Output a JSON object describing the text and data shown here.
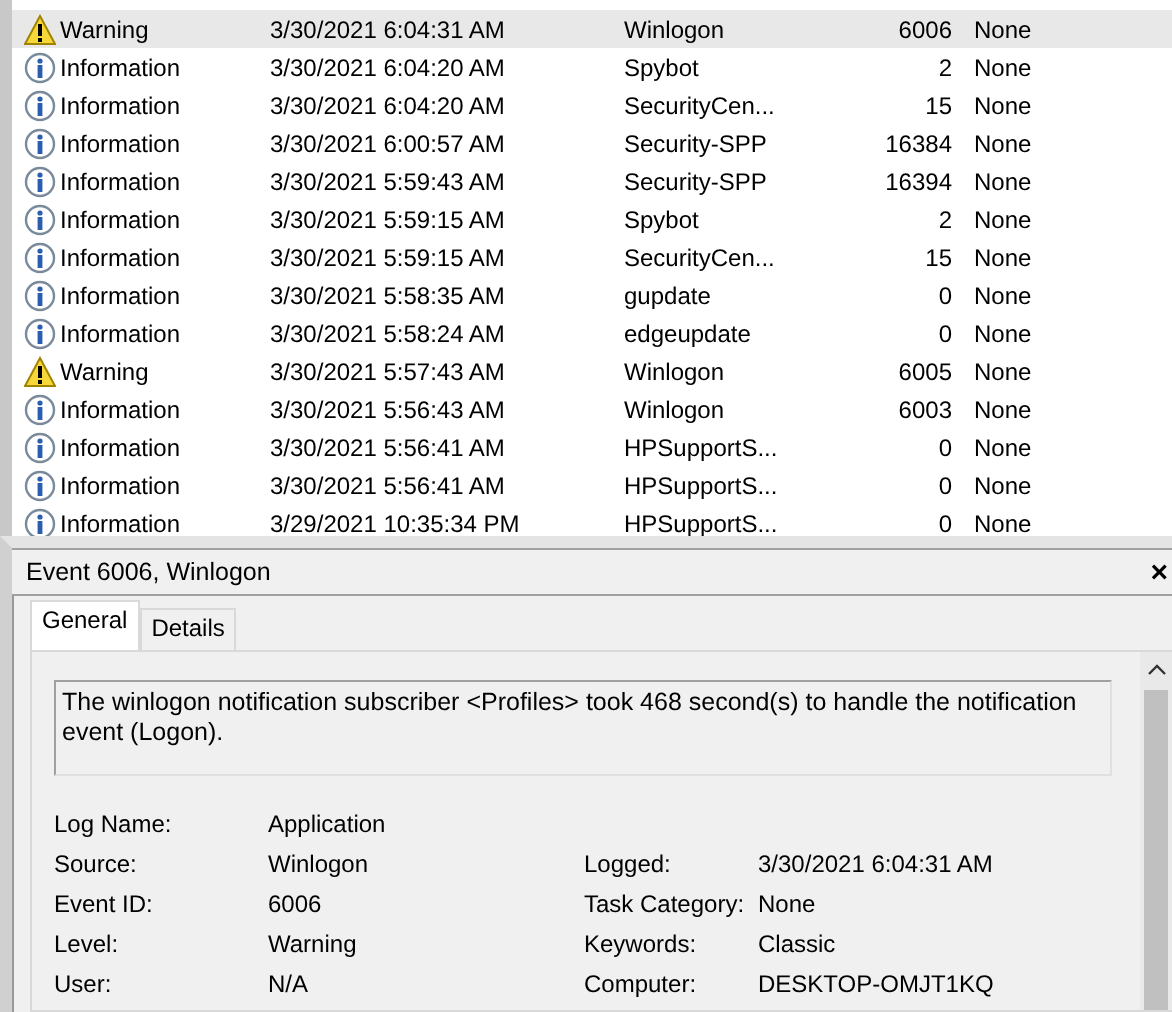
{
  "events": [
    {
      "kind": "warning",
      "level": "Warning",
      "date": "3/30/2021 6:04:31 AM",
      "source": "Winlogon",
      "event_id": "6006",
      "task": "None",
      "selected": true
    },
    {
      "kind": "information",
      "level": "Information",
      "date": "3/30/2021 6:04:20 AM",
      "source": "Spybot",
      "event_id": "2",
      "task": "None",
      "selected": false
    },
    {
      "kind": "information",
      "level": "Information",
      "date": "3/30/2021 6:04:20 AM",
      "source": "SecurityCen...",
      "event_id": "15",
      "task": "None",
      "selected": false
    },
    {
      "kind": "information",
      "level": "Information",
      "date": "3/30/2021 6:00:57 AM",
      "source": "Security-SPP",
      "event_id": "16384",
      "task": "None",
      "selected": false
    },
    {
      "kind": "information",
      "level": "Information",
      "date": "3/30/2021 5:59:43 AM",
      "source": "Security-SPP",
      "event_id": "16394",
      "task": "None",
      "selected": false
    },
    {
      "kind": "information",
      "level": "Information",
      "date": "3/30/2021 5:59:15 AM",
      "source": "Spybot",
      "event_id": "2",
      "task": "None",
      "selected": false
    },
    {
      "kind": "information",
      "level": "Information",
      "date": "3/30/2021 5:59:15 AM",
      "source": "SecurityCen...",
      "event_id": "15",
      "task": "None",
      "selected": false
    },
    {
      "kind": "information",
      "level": "Information",
      "date": "3/30/2021 5:58:35 AM",
      "source": "gupdate",
      "event_id": "0",
      "task": "None",
      "selected": false
    },
    {
      "kind": "information",
      "level": "Information",
      "date": "3/30/2021 5:58:24 AM",
      "source": "edgeupdate",
      "event_id": "0",
      "task": "None",
      "selected": false
    },
    {
      "kind": "warning",
      "level": "Warning",
      "date": "3/30/2021 5:57:43 AM",
      "source": "Winlogon",
      "event_id": "6005",
      "task": "None",
      "selected": false
    },
    {
      "kind": "information",
      "level": "Information",
      "date": "3/30/2021 5:56:43 AM",
      "source": "Winlogon",
      "event_id": "6003",
      "task": "None",
      "selected": false
    },
    {
      "kind": "information",
      "level": "Information",
      "date": "3/30/2021 5:56:41 AM",
      "source": "HPSupportS...",
      "event_id": "0",
      "task": "None",
      "selected": false
    },
    {
      "kind": "information",
      "level": "Information",
      "date": "3/30/2021 5:56:41 AM",
      "source": "HPSupportS...",
      "event_id": "0",
      "task": "None",
      "selected": false
    },
    {
      "kind": "information",
      "level": "Information",
      "date": "3/29/2021 10:35:34 PM",
      "source": "HPSupportS...",
      "event_id": "0",
      "task": "None",
      "selected": false
    }
  ],
  "detail": {
    "title": "Event 6006, Winlogon",
    "close": "×",
    "tabs": [
      {
        "label": "General",
        "selected": true
      },
      {
        "label": "Details",
        "selected": false
      }
    ],
    "message": "The winlogon notification subscriber <Profiles> took 468 second(s) to handle the notification event (Logon).",
    "rows": [
      {
        "left": {
          "label": "Log Name:",
          "value": "Application"
        }
      },
      {
        "left": {
          "label": "Source:",
          "value": "Winlogon"
        },
        "right": {
          "label": "Logged:",
          "value": "3/30/2021 6:04:31 AM"
        }
      },
      {
        "left": {
          "label": "Event ID:",
          "value": "6006"
        },
        "right": {
          "label": "Task Category:",
          "value": "None"
        }
      },
      {
        "left": {
          "label": "Level:",
          "value": "Warning"
        },
        "right": {
          "label": "Keywords:",
          "value": "Classic"
        }
      },
      {
        "left": {
          "label": "User:",
          "value": "N/A"
        },
        "right": {
          "label": "Computer:",
          "value": "DESKTOP-OMJT1KQ"
        }
      }
    ]
  }
}
